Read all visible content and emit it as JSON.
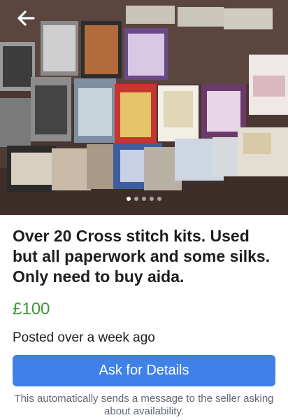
{
  "listing": {
    "title": "Over 20 Cross stitch kits. Used but all paperwork and some silks. Only need to buy aida.",
    "price": "£100",
    "posted": "Posted over a week ago"
  },
  "actions": {
    "ask_label": "Ask for Details",
    "ask_note": "This automatically sends a message to the seller asking about availability."
  },
  "photo": {
    "image_count": 5,
    "active_index": 0,
    "description_icon": "photo"
  },
  "nav": {
    "back_icon": "arrow-left-icon"
  },
  "colors": {
    "accent": "#3f81e8",
    "price": "#3a9a36",
    "text": "#1c1e21",
    "muted": "#606770"
  }
}
